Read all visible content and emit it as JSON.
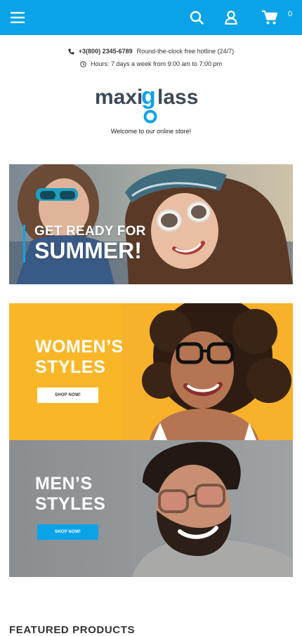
{
  "header": {
    "menu_icon": "hamburger-menu-icon",
    "search_icon": "search-icon",
    "account_icon": "user-icon",
    "cart_icon": "shopping-cart-icon",
    "cart_count": "0",
    "accent": "#0aa3e8"
  },
  "contact": {
    "phone": "+3(800) 2345-6789",
    "hotline": "Round-the-clock free hotline (24/7)",
    "hours": "Hours: 7 days a week from 9:00 am to 7:00 pm"
  },
  "brand": {
    "logo_left": "maxi",
    "logo_g": "g",
    "logo_right": "lass",
    "tagline": "Welcome to our online store!"
  },
  "banners": {
    "summer": {
      "line1": "GET READY FOR",
      "line2": "SUMMER!"
    },
    "women": {
      "line1": "WOMEN’S",
      "line2": "STYLES",
      "button": "SHOP NOW!",
      "bg": "#f9b728"
    },
    "men": {
      "line1": "MEN’S",
      "line2": "STYLES",
      "button": "SHOP NOW!",
      "bg": "#8f9396"
    }
  },
  "featured": {
    "title": "FEATURED PRODUCTS"
  }
}
